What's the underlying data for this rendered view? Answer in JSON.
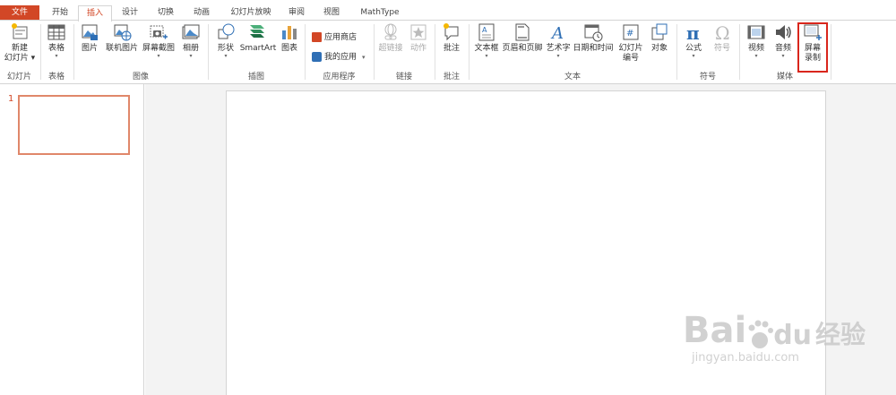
{
  "tabs": [
    "文件",
    "开始",
    "插入",
    "设计",
    "切换",
    "动画",
    "幻灯片放映",
    "审阅",
    "视图",
    "MathType"
  ],
  "groups": {
    "slides": {
      "label": "幻灯片",
      "new_slide_1": "新建",
      "new_slide_2": "幻灯片"
    },
    "tables": {
      "label": "表格",
      "table": "表格"
    },
    "images": {
      "label": "图像",
      "picture": "图片",
      "online_picture": "联机图片",
      "screenshot": "屏幕截图",
      "album": "相册"
    },
    "illustrations": {
      "label": "插图",
      "shapes": "形状",
      "smartart": "SmartArt",
      "chart": "图表"
    },
    "apps": {
      "label": "应用程序",
      "store": "应用商店",
      "my_apps": "我的应用"
    },
    "links": {
      "label": "链接",
      "hyperlink": "超链接",
      "action": "动作"
    },
    "comments": {
      "label": "批注",
      "comment": "批注"
    },
    "text": {
      "label": "文本",
      "textbox": "文本框",
      "header_footer": "页眉和页脚",
      "wordart": "艺术字",
      "datetime": "日期和时间",
      "slide_number_1": "幻灯片",
      "slide_number_2": "编号",
      "object": "对象"
    },
    "symbols": {
      "label": "符号",
      "equation": "公式",
      "symbol": "符号"
    },
    "media": {
      "label": "媒体",
      "video": "视频",
      "audio": "音频",
      "screen_recording_1": "屏幕",
      "screen_recording_2": "录制"
    }
  },
  "slide_panel": {
    "slide_number": "1"
  },
  "watermark": {
    "brand": "Bai",
    "brand2": "经验",
    "url": "jingyan.baidu.com"
  },
  "colors": {
    "accent": "#d24726",
    "highlight": "#d9261c"
  }
}
